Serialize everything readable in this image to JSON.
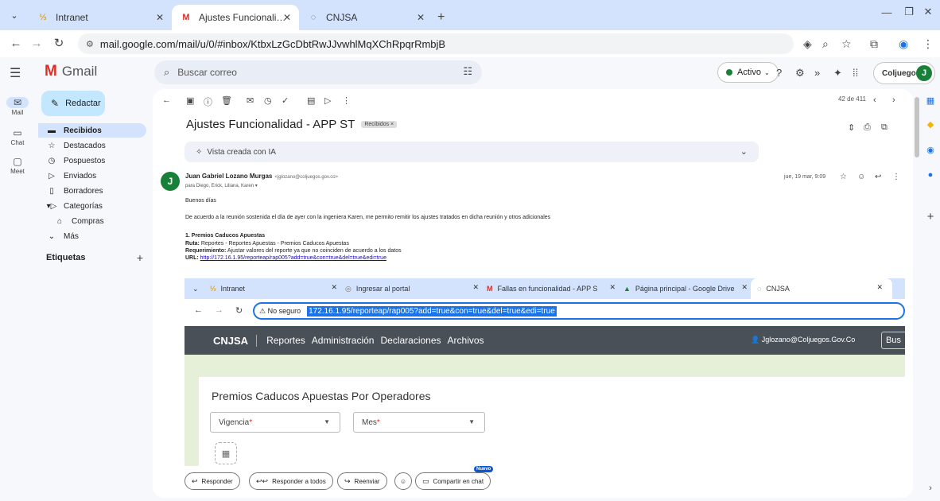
{
  "browser": {
    "tabs": [
      {
        "label": "Intranet",
        "favicon": "intranet-logo-icon",
        "active": false
      },
      {
        "label": "Ajustes Funcionalidad - APP ST",
        "favicon": "gmail-icon",
        "active": true
      },
      {
        "label": "CNJSA",
        "favicon": "loading-icon",
        "active": false
      }
    ],
    "new_tab": "+",
    "url": "mail.google.com/mail/u/0/#inbox/KtbxLzGcDbtRwJJvwhlMqXChRpqrRmbjB"
  },
  "gmail": {
    "app_name": "Gmail",
    "search_placeholder": "Buscar correo",
    "status": "Activo",
    "account": "Coljuegos",
    "avatar_letter": "J",
    "rail": [
      {
        "label": "Mail",
        "icon": "mail-icon"
      },
      {
        "label": "Chat",
        "icon": "chat-icon"
      },
      {
        "label": "Meet",
        "icon": "meet-icon"
      }
    ],
    "compose": "Redactar",
    "nav": [
      {
        "label": "Recibidos",
        "icon": "inbox-icon",
        "active": true
      },
      {
        "label": "Destacados",
        "icon": "star-icon"
      },
      {
        "label": "Pospuestos",
        "icon": "clock-icon"
      },
      {
        "label": "Enviados",
        "icon": "send-icon"
      },
      {
        "label": "Borradores",
        "icon": "draft-icon"
      },
      {
        "label": "Categorías",
        "icon": "label-icon"
      },
      {
        "label": "Compras",
        "icon": "shopping-icon"
      },
      {
        "label": "Más",
        "icon": "chevron-down-icon"
      }
    ],
    "labels_heading": "Etiquetas"
  },
  "mail": {
    "counter": "42 de 411",
    "subject": "Ajustes Funcionalidad - APP ST",
    "label_chip": "Recibidos ×",
    "ai_banner": "Vista creada con IA",
    "sender_name": "Juan Gabriel Lozano Murgas",
    "sender_email": "<jglozano@coljuegos.gov.co>",
    "recipients": "para Diego, Erick, Liliana, Karen ▾",
    "date": "jue, 19 mar, 9:09",
    "greeting": "Buenos días",
    "intro": "De acuerdo a la reunión sostenida el día de ayer con la ingeniera Karen, me permito remitir los ajustes tratados en dicha reunión y otros adicionales",
    "item_title": "1. Premios Caducos Apuestas",
    "ruta_label": "Ruta:",
    "ruta_value": "Reportes - Reportes Apuestas - Premios Caducos Apuestas",
    "req_label": "Requerimiento:",
    "req_value": "Ajustar valores del reporte ya que no coinciden de acuerdo a los datos",
    "url_label": "URL:",
    "url_value": "http://172.16.1.95/reporteap/rap005?add=true&con=true&del=true&edi=true"
  },
  "embedded": {
    "tabs": [
      {
        "label": "Intranet"
      },
      {
        "label": "Ingresar al portal"
      },
      {
        "label": "Fallas en funcionalidad - APP S"
      },
      {
        "label": "Página principal - Google Drive"
      },
      {
        "label": "CNJSA"
      }
    ],
    "not_secure": "⚠ No seguro",
    "url": "172.16.1.95/reporteap/rap005?add=true&con=true&del=true&edi=true",
    "brand": "CNJSA",
    "menu": [
      "Reportes",
      "Administración",
      "Declaraciones",
      "Archivos"
    ],
    "user": "👤 Jglozano@Coljuegos.Gov.Co",
    "search_btn": "Bus",
    "page_title": "Premios Caducos Apuestas Por Operadores",
    "select1": "Vigencia",
    "select2": "Mes",
    "required_mark": "*"
  },
  "actions": {
    "reply": "Responder",
    "reply_all": "Responder a todos",
    "forward": "Reenviar",
    "share": "Compartir en chat",
    "new_badge": "Nuevo"
  }
}
